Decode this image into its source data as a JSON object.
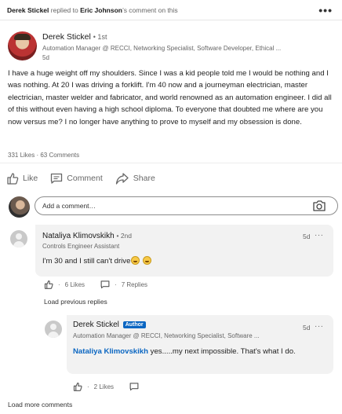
{
  "activity": {
    "actor": "Derek Stickel",
    "verb": " replied to ",
    "target": "Eric Johnson",
    "suffix": "’s comment on this",
    "more_icon": "more-icon"
  },
  "post": {
    "author_name": "Derek Stickel",
    "author_degree": "• 1st",
    "author_headline": "Automation Manager @ RECCI, Networking Specialist, Software Developer, Ethical ...",
    "time": "5d",
    "body": "I have a huge weight off my shoulders. Since I was a kid people told me I would be nothing and I was nothing. At 20 I was driving a forklift. I'm 40 now and a journeyman electrician, master electrician, master welder and fabricator, and world renowned as an automation engineer. I did all of this without even having a high school diploma. To everyone that doubted me where are you now versus me? I no longer have anything to prove to myself and my obsession is done.",
    "social_counts": "331 Likes · 63 Comments"
  },
  "actions": {
    "like": "Like",
    "comment": "Comment",
    "share": "Share"
  },
  "compose": {
    "placeholder": "Add a comment…",
    "icon": "camera-icon"
  },
  "comment1": {
    "name": "Nataliya Klimovskikh",
    "degree": "• 2nd",
    "headline": "Controls Engineer Assistant",
    "time": "5d",
    "text": "I'm 30 and I still can't drive",
    "likes": "6 Likes",
    "replies": "7 Replies"
  },
  "load_previous": "Load previous replies",
  "reply1": {
    "name": "Derek Stickel",
    "badge": "Author",
    "headline": "Automation Manager @ RECCI, Networking Specialist, Software ...",
    "time": "5d",
    "mention": "Nataliya Klimovskikh",
    "text": " yes.....my next impossible. That's what I do.",
    "likes": "2 Likes"
  },
  "load_more": "Load more comments",
  "colors": {
    "accent": "#0a66c2",
    "comment_bg": "#f2f2f2",
    "muted": "#666666"
  }
}
